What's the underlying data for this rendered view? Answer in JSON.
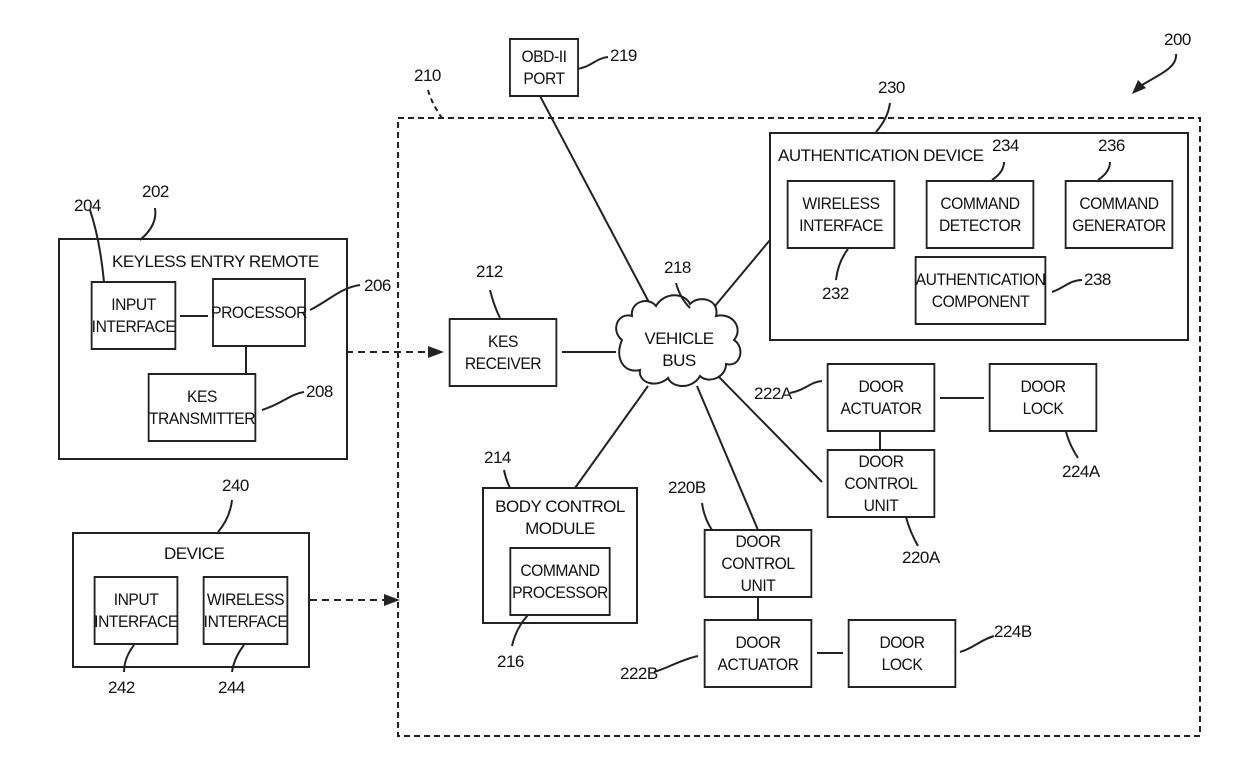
{
  "figure_ref": "200",
  "system": {
    "ref": "210"
  },
  "keyless_entry_remote": {
    "ref": "202",
    "title": "KEYLESS ENTRY REMOTE",
    "input_interface": {
      "label": "INPUT\nINTERFACE",
      "ref": "204"
    },
    "processor": {
      "label": "PROCESSOR",
      "ref": "206"
    },
    "kes_transmitter": {
      "label": "KES\nTRANSMITTER",
      "ref": "208"
    }
  },
  "device": {
    "ref": "240",
    "title": "DEVICE",
    "input_interface": {
      "label": "INPUT\nINTERFACE",
      "ref": "242"
    },
    "wireless_interface": {
      "label": "WIRELESS\nINTERFACE",
      "ref": "244"
    }
  },
  "obd_port": {
    "label": "OBD-II\nPORT",
    "ref": "219"
  },
  "kes_receiver": {
    "label": "KES\nRECEIVER",
    "ref": "212"
  },
  "vehicle_bus": {
    "label": "VEHICLE\nBUS",
    "ref": "218"
  },
  "authentication_device": {
    "ref": "230",
    "title": "AUTHENTICATION DEVICE",
    "wireless_interface": {
      "label": "WIRELESS\nINTERFACE",
      "ref": "232"
    },
    "command_detector": {
      "label": "COMMAND\nDETECTOR",
      "ref": "234"
    },
    "command_generator": {
      "label": "COMMAND\nGENERATOR",
      "ref": "236"
    },
    "authentication_component": {
      "label": "AUTHENTICATION\nCOMPONENT",
      "ref": "238"
    }
  },
  "body_control_module": {
    "ref": "214",
    "title": "BODY CONTROL\nMODULE",
    "command_processor": {
      "label": "COMMAND\nPROCESSOR",
      "ref": "216"
    }
  },
  "door_a": {
    "actuator": {
      "label": "DOOR\nACTUATOR",
      "ref": "222A"
    },
    "lock": {
      "label": "DOOR\nLOCK",
      "ref": "224A"
    },
    "control_unit": {
      "label": "DOOR\nCONTROL UNIT",
      "ref": "220A"
    }
  },
  "door_b": {
    "control_unit": {
      "label": "DOOR\nCONTROL UNIT",
      "ref": "220B"
    },
    "actuator": {
      "label": "DOOR\nACTUATOR",
      "ref": "222B"
    },
    "lock": {
      "label": "DOOR\nLOCK",
      "ref": "224B"
    }
  },
  "colors": {
    "ink": "#222222",
    "background": "#ffffff"
  }
}
